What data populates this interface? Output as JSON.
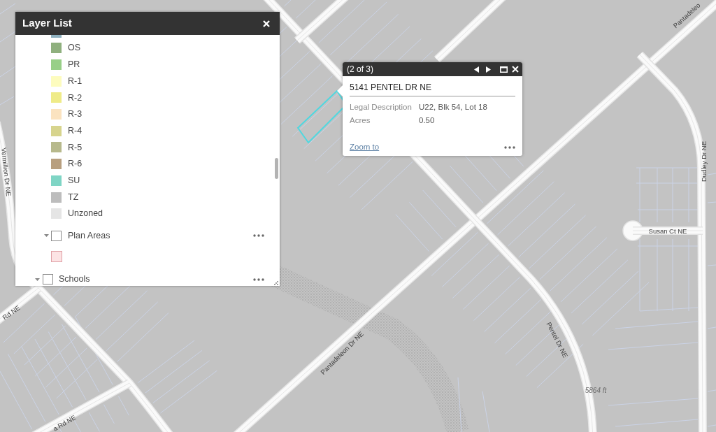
{
  "layer_list": {
    "title": "Layer List",
    "group": {
      "legend": [
        {
          "color": "#8fb1c0",
          "clipped": true
        },
        {
          "label": "OS",
          "color": "#8fb07e",
          "clipped": false
        },
        {
          "label": "PR",
          "color": "#98cf88",
          "clipped": false
        },
        {
          "label": "R-1",
          "color": "#fdfcbe",
          "clipped": false
        },
        {
          "label": "R-2",
          "color": "#efeb88",
          "clipped": false
        },
        {
          "label": "R-3",
          "color": "#fbe3c0",
          "clipped": false
        },
        {
          "label": "R-4",
          "color": "#d7d48d",
          "clipped": false
        },
        {
          "label": "R-5",
          "color": "#b7b98c",
          "clipped": false
        },
        {
          "label": "R-6",
          "color": "#b89f7f",
          "clipped": false
        },
        {
          "label": "SU",
          "color": "#7fd5c5",
          "clipped": false
        },
        {
          "label": "TZ",
          "color": "#bdbdbd",
          "clipped": false
        },
        {
          "label": "Unzoned",
          "color": "#e5e5e5",
          "clipped": false
        }
      ],
      "sublayers": [
        {
          "name": "Plan Areas",
          "expanded": true,
          "checked": false,
          "legend": [
            {
              "color": "#fce3e4"
            }
          ]
        }
      ]
    },
    "layers": [
      {
        "name": "Schools",
        "expanded": true,
        "checked": false
      }
    ]
  },
  "popup": {
    "counter": "(2 of 3)",
    "title": "5141 PENTEL DR NE",
    "fields": [
      {
        "label": "Legal Description",
        "value": "U22, Blk 54, Lot 18"
      },
      {
        "label": "Acres",
        "value": "0.50"
      }
    ],
    "link": "Zoom to"
  },
  "map": {
    "labels": [
      {
        "text": "Pantadeleo",
        "kind": "street"
      },
      {
        "text": "Vermillion Dr NE",
        "kind": "street"
      },
      {
        "text": "Susan Ct NE",
        "kind": "street"
      },
      {
        "text": "Dudley Dr NE",
        "kind": "street"
      },
      {
        "text": "Rd NE",
        "kind": "street"
      },
      {
        "text": "Pantadeleon Dr NE",
        "kind": "street"
      },
      {
        "text": "Pentel Dr NE",
        "kind": "street"
      },
      {
        "text": "5864 ft",
        "kind": "elevation"
      },
      {
        "text": "a Rd NE",
        "kind": "street"
      }
    ]
  }
}
